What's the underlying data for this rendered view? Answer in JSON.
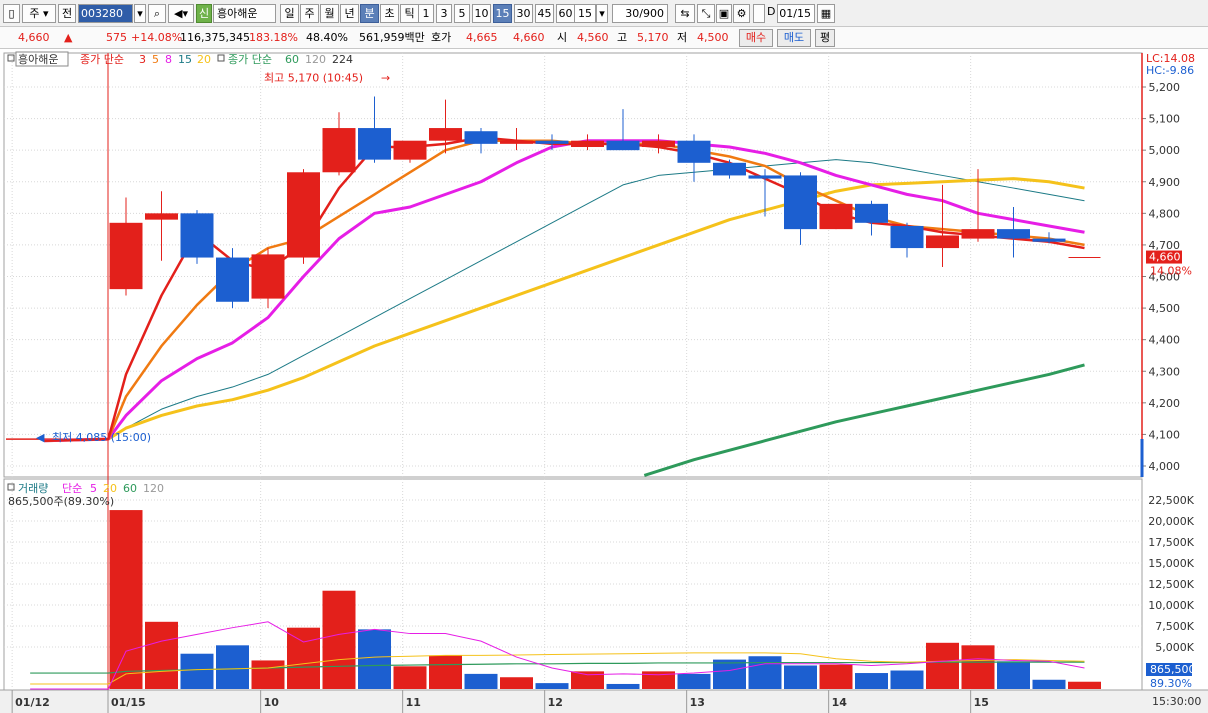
{
  "toolbar": {
    "market": "주",
    "prev": "전",
    "code": "003280",
    "credit_badge": "신",
    "stock_name": "흥아해운",
    "periods": [
      "일",
      "주",
      "월",
      "년",
      "분",
      "초",
      "틱"
    ],
    "active_period": "분",
    "intervals": [
      "1",
      "3",
      "5",
      "10",
      "15",
      "30",
      "45",
      "60"
    ],
    "active_interval": "15",
    "interval_value": "15",
    "count": "30/900",
    "date": "01/15",
    "d_label": "D"
  },
  "quote": {
    "price": "4,660",
    "arrow": "▲",
    "change": "575",
    "rate": "+14.08%",
    "volume": "116,375,345",
    "vol_ratio": "183.18%",
    "turnover": "48.40%",
    "amount": "561,959백만",
    "bid_label": "호가",
    "ask": "4,665",
    "bid": "4,660",
    "open_label": "시",
    "open": "4,560",
    "high_label": "고",
    "high": "5,170",
    "low_label": "저",
    "low": "4,500",
    "buy": "매수",
    "sell": "매도",
    "avg": "평"
  },
  "price_legend": {
    "name": "흥아해운",
    "ma_label": "종가 단순",
    "ma_short": [
      "3",
      "5",
      "8",
      "15",
      "20"
    ],
    "ma_label2": "종가 단순",
    "ma_long": [
      "60",
      "120",
      "224"
    ]
  },
  "vol_legend": {
    "title": "거래량",
    "ma_label": "단순",
    "periods": [
      "5",
      "20",
      "60",
      "120"
    ],
    "current": "865,500주(89.30%)"
  },
  "right_panel": {
    "lc": "LC:14.08",
    "hc": "HC:-9.86",
    "price_tag": "4,660",
    "rate_tag": "14.08%",
    "vol_tag": "865,500",
    "vol_rate_tag": "89.30%",
    "time_tag": "15:30:00"
  },
  "colors": {
    "up": "#e3201b",
    "down": "#1c5fd0",
    "ma3": "#e3201b",
    "ma5": "#f07a12",
    "ma8": "#e61ee6",
    "ma15": "#1c7a86",
    "ma20": "#f5c21b",
    "ma60": "#2e9a5b",
    "vol_ma5": "#e61ee6",
    "vol_ma20": "#f5c21b",
    "vol_ma60": "#2e9a5b"
  },
  "chart_data": {
    "type": "candlestick",
    "price_ylim": [
      3960,
      5250
    ],
    "price_ticks": [
      4000,
      4100,
      4200,
      4300,
      4400,
      4500,
      4600,
      4700,
      4800,
      4900,
      5000,
      5100,
      5200
    ],
    "volume_ylim": [
      0,
      23000
    ],
    "volume_ticks": [
      5000,
      7500,
      10000,
      12500,
      15000,
      17500,
      20000,
      22500
    ],
    "volume_tick_labels": [
      "5,000K",
      "7,500K",
      "10,000K",
      "12,500K",
      "15,000K",
      "17,500K",
      "20,000K",
      "22,500K"
    ],
    "x_labels": [
      {
        "i": -2.7,
        "label": "01/12"
      },
      {
        "i": 0,
        "label": "01/15"
      },
      {
        "i": 4.3,
        "label": "10"
      },
      {
        "i": 8.3,
        "label": "11"
      },
      {
        "i": 12.3,
        "label": "12"
      },
      {
        "i": 16.3,
        "label": "13"
      },
      {
        "i": 20.3,
        "label": "14"
      },
      {
        "i": 24.3,
        "label": "15"
      }
    ],
    "annotations": {
      "high": {
        "i": 8,
        "value": 5170,
        "label": "최고 5,170 (10:45)"
      },
      "low": {
        "i": -1.6,
        "value": 4085,
        "label": "최저 4,085 (15:00)"
      }
    },
    "prev_close": 4085,
    "candles": [
      {
        "o": 4560,
        "h": 4850,
        "l": 4540,
        "c": 4770,
        "v": 21300
      },
      {
        "o": 4780,
        "h": 4870,
        "l": 4650,
        "c": 4800,
        "v": 8000
      },
      {
        "o": 4800,
        "h": 4810,
        "l": 4640,
        "c": 4660,
        "v": 4200
      },
      {
        "o": 4660,
        "h": 4690,
        "l": 4500,
        "c": 4520,
        "v": 5200
      },
      {
        "o": 4530,
        "h": 4690,
        "l": 4500,
        "c": 4670,
        "v": 3400
      },
      {
        "o": 4660,
        "h": 4940,
        "l": 4640,
        "c": 4930,
        "v": 7300
      },
      {
        "o": 4930,
        "h": 5120,
        "l": 4920,
        "c": 5070,
        "v": 11700
      },
      {
        "o": 5070,
        "h": 5170,
        "l": 4960,
        "c": 4970,
        "v": 7100
      },
      {
        "o": 4970,
        "h": 5020,
        "l": 4960,
        "c": 5030,
        "v": 2700
      },
      {
        "o": 5030,
        "h": 5160,
        "l": 4990,
        "c": 5070,
        "v": 4000
      },
      {
        "o": 5060,
        "h": 5070,
        "l": 4990,
        "c": 5020,
        "v": 1800
      },
      {
        "o": 5020,
        "h": 5070,
        "l": 5000,
        "c": 5030,
        "v": 1400
      },
      {
        "o": 5030,
        "h": 5050,
        "l": 5000,
        "c": 5020,
        "v": 700
      },
      {
        "o": 5010,
        "h": 5050,
        "l": 5000,
        "c": 5030,
        "v": 2100
      },
      {
        "o": 5030,
        "h": 5130,
        "l": 5000,
        "c": 5000,
        "v": 600
      },
      {
        "o": 5010,
        "h": 5050,
        "l": 4990,
        "c": 5030,
        "v": 2100
      },
      {
        "o": 5030,
        "h": 5050,
        "l": 4900,
        "c": 4960,
        "v": 1800
      },
      {
        "o": 4960,
        "h": 4970,
        "l": 4910,
        "c": 4920,
        "v": 3500
      },
      {
        "o": 4920,
        "h": 4940,
        "l": 4790,
        "c": 4910,
        "v": 3900
      },
      {
        "o": 4920,
        "h": 4930,
        "l": 4700,
        "c": 4750,
        "v": 2800
      },
      {
        "o": 4750,
        "h": 4830,
        "l": 4750,
        "c": 4830,
        "v": 2900
      },
      {
        "o": 4830,
        "h": 4840,
        "l": 4730,
        "c": 4770,
        "v": 1900
      },
      {
        "o": 4760,
        "h": 4770,
        "l": 4660,
        "c": 4690,
        "v": 2200
      },
      {
        "o": 4690,
        "h": 4890,
        "l": 4630,
        "c": 4730,
        "v": 5500
      },
      {
        "o": 4720,
        "h": 4940,
        "l": 4710,
        "c": 4750,
        "v": 5200
      },
      {
        "o": 4750,
        "h": 4820,
        "l": 4660,
        "c": 4720,
        "v": 3300
      },
      {
        "o": 4720,
        "h": 4740,
        "l": 4705,
        "c": 4710,
        "v": 1100
      },
      {
        "o": 4660,
        "h": 4660,
        "l": 4660,
        "c": 4660,
        "v": 865
      }
    ],
    "ma": {
      "ma3": {
        "x": [
          -2.3,
          -0.5,
          0,
          1,
          2,
          3,
          4,
          5,
          6,
          7,
          8,
          9,
          10,
          11,
          12,
          13,
          14,
          15,
          16,
          17,
          18,
          19,
          20,
          21,
          22,
          23,
          24,
          25,
          26,
          27
        ],
        "y": [
          4080,
          4085,
          4290,
          4540,
          4740,
          4650,
          4620,
          4700,
          4880,
          5010,
          5010,
          5020,
          5040,
          5030,
          5020,
          5020,
          5020,
          5010,
          4990,
          4960,
          4910,
          4860,
          4800,
          4770,
          4760,
          4740,
          4730,
          4720,
          4710,
          4690
        ]
      },
      "ma5": {
        "x": [
          -2.3,
          -0.5,
          0,
          1,
          2,
          3,
          4,
          5,
          6,
          7,
          8,
          9,
          10,
          11,
          12,
          13,
          14,
          15,
          16,
          17,
          18,
          19,
          20,
          21,
          22,
          23,
          24,
          25,
          26,
          27
        ],
        "y": [
          4080,
          4085,
          4220,
          4380,
          4510,
          4620,
          4690,
          4720,
          4790,
          4860,
          4930,
          5000,
          5030,
          5030,
          5030,
          5020,
          5020,
          5020,
          5000,
          4980,
          4950,
          4890,
          4840,
          4790,
          4760,
          4750,
          4740,
          4730,
          4720,
          4700
        ]
      },
      "ma8": {
        "x": [
          -2.3,
          -0.5,
          0,
          1,
          2,
          3,
          4,
          5,
          6,
          7,
          8,
          9,
          10,
          11,
          12,
          13,
          14,
          15,
          16,
          17,
          18,
          19,
          20,
          21,
          22,
          23,
          24,
          25,
          26,
          27
        ],
        "y": [
          4080,
          4085,
          4160,
          4270,
          4340,
          4390,
          4470,
          4600,
          4720,
          4800,
          4820,
          4860,
          4900,
          4960,
          5010,
          5030,
          5030,
          5030,
          5020,
          5010,
          4990,
          4960,
          4920,
          4890,
          4860,
          4840,
          4800,
          4780,
          4760,
          4740
        ]
      },
      "ma15": {
        "x": [
          -2.3,
          -0.5,
          0,
          1,
          2,
          3,
          4,
          5,
          6,
          7,
          8,
          9,
          10,
          11,
          12,
          13,
          14,
          15,
          16,
          17,
          18,
          19,
          20,
          21,
          22,
          23,
          24,
          25,
          26,
          27
        ],
        "y": [
          4080,
          4085,
          4120,
          4180,
          4220,
          4250,
          4290,
          4350,
          4410,
          4470,
          4530,
          4590,
          4650,
          4710,
          4770,
          4830,
          4890,
          4920,
          4930,
          4940,
          4950,
          4960,
          4970,
          4960,
          4940,
          4920,
          4900,
          4880,
          4860,
          4840
        ]
      },
      "ma20": {
        "x": [
          -2.3,
          -0.5,
          0,
          1,
          2,
          3,
          4,
          5,
          6,
          7,
          8,
          9,
          10,
          11,
          12,
          13,
          14,
          15,
          16,
          17,
          18,
          19,
          20,
          21,
          22,
          23,
          24,
          25,
          26,
          27
        ],
        "y": [
          4080,
          4085,
          4120,
          4160,
          4190,
          4210,
          4240,
          4280,
          4330,
          4380,
          4420,
          4460,
          4500,
          4540,
          4580,
          4620,
          4660,
          4700,
          4740,
          4780,
          4810,
          4840,
          4870,
          4890,
          4895,
          4900,
          4905,
          4910,
          4900,
          4880
        ]
      },
      "ma60": {
        "x": [
          14.6,
          16,
          18,
          20,
          22,
          24,
          26,
          27
        ],
        "y": [
          3970,
          4020,
          4080,
          4140,
          4190,
          4240,
          4290,
          4320
        ]
      }
    },
    "vol_ma": {
      "ma5": {
        "x": [
          -2.7,
          -0.5,
          0,
          1,
          2,
          3,
          4,
          5,
          6,
          7,
          8,
          9,
          10,
          11,
          12,
          13,
          14,
          15,
          16,
          17,
          18,
          19,
          20,
          21,
          22,
          23,
          24,
          25,
          26,
          27
        ],
        "y": [
          0,
          0,
          4500,
          5700,
          6500,
          7300,
          8000,
          5600,
          6500,
          7100,
          6600,
          6600,
          5700,
          3800,
          2500,
          1700,
          1800,
          1700,
          1900,
          2200,
          3000,
          3000,
          3000,
          2800,
          3000,
          3300,
          3600,
          3400,
          3300,
          2500
        ]
      },
      "ma20": {
        "x": [
          -2.7,
          -0.5,
          0,
          1,
          2,
          3,
          4,
          5,
          6,
          7,
          8,
          9,
          10,
          11,
          12,
          13,
          14,
          15,
          16,
          17,
          18,
          19,
          20,
          21,
          22,
          23,
          24,
          25,
          26,
          27
        ],
        "y": [
          600,
          600,
          1800,
          2100,
          2300,
          2400,
          2500,
          3000,
          3500,
          3800,
          3900,
          4000,
          4000,
          4050,
          4100,
          4150,
          4200,
          4250,
          4300,
          4300,
          4300,
          4200,
          3600,
          3300,
          3200,
          3300,
          3400,
          3500,
          3400,
          3300
        ]
      },
      "ma60": {
        "x": [
          -2.7,
          -0.5,
          0,
          1,
          2,
          3,
          4,
          5,
          6,
          7,
          8,
          9,
          10,
          11,
          12,
          13,
          14,
          15,
          16,
          17,
          18,
          19,
          20,
          21,
          22,
          23,
          24,
          25,
          26,
          27
        ],
        "y": [
          1900,
          1900,
          2100,
          2200,
          2300,
          2400,
          2500,
          2600,
          2700,
          2800,
          2850,
          2900,
          2950,
          3000,
          3000,
          3050,
          3050,
          3100,
          3100,
          3100,
          3150,
          3150,
          3150,
          3150,
          3150,
          3200,
          3200,
          3200,
          3200,
          3200
        ]
      }
    }
  }
}
